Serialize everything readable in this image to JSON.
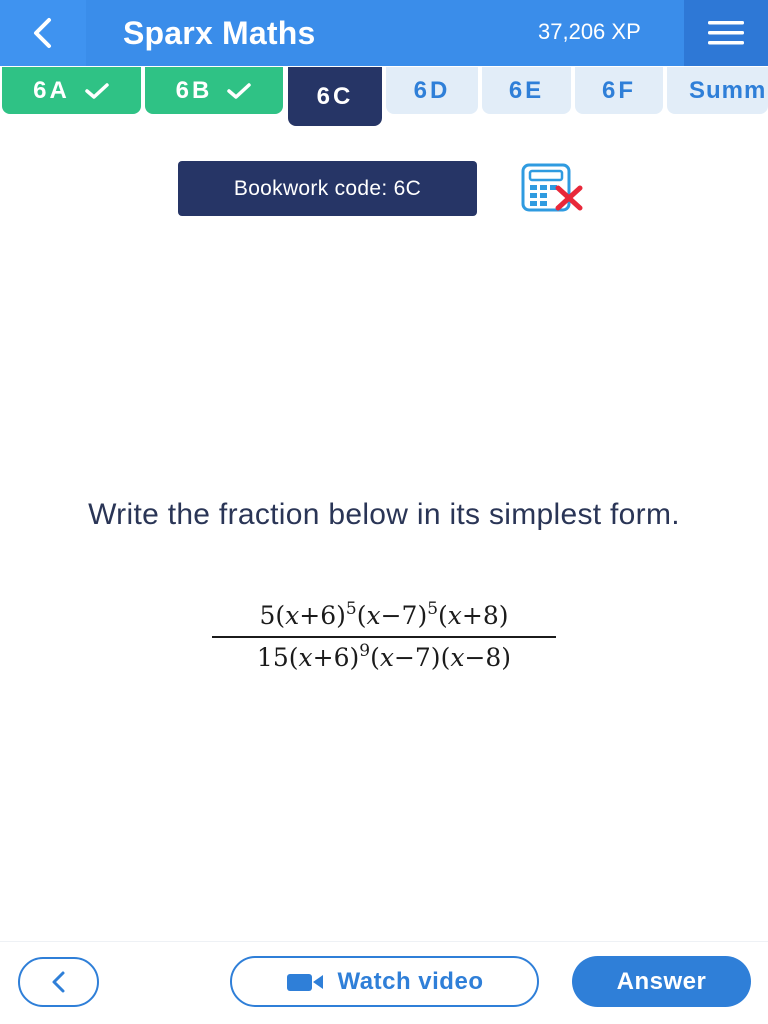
{
  "header": {
    "title": "Sparx Maths",
    "xp": "37,206 XP",
    "color": "#3a8dea"
  },
  "tabs": [
    {
      "label": "6A",
      "state": "complete"
    },
    {
      "label": "6B",
      "state": "complete"
    },
    {
      "label": "6C",
      "state": "active"
    },
    {
      "label": "6D",
      "state": "todo"
    },
    {
      "label": "6E",
      "state": "todo"
    },
    {
      "label": "6F",
      "state": "todo"
    },
    {
      "label": "Summ",
      "state": "todo"
    }
  ],
  "bookwork": {
    "label": "Bookwork code: 6C"
  },
  "calculator_icon": "calculator-not-allowed-icon",
  "question": {
    "prompt": "Write the fraction below in its simplest form.",
    "numerator": {
      "coefficient": "5",
      "factors": [
        {
          "base": "(x+6)",
          "exp": "5"
        },
        {
          "base": "(x−7)",
          "exp": "5"
        },
        {
          "base": "(x+8)",
          "exp": ""
        }
      ]
    },
    "denominator": {
      "coefficient": "15",
      "factors": [
        {
          "base": "(x+6)",
          "exp": "9"
        },
        {
          "base": "(x−7)",
          "exp": ""
        },
        {
          "base": "(x−8)",
          "exp": ""
        }
      ]
    }
  },
  "footer": {
    "back_icon": "chevron-left-icon",
    "video_label": "Watch video",
    "video_icon": "video-camera-icon",
    "answer_label": "Answer"
  },
  "colors": {
    "complete": "#2fc285",
    "active": "#263566",
    "todo": "#e2edf8",
    "accent": "#2f7fd8"
  }
}
